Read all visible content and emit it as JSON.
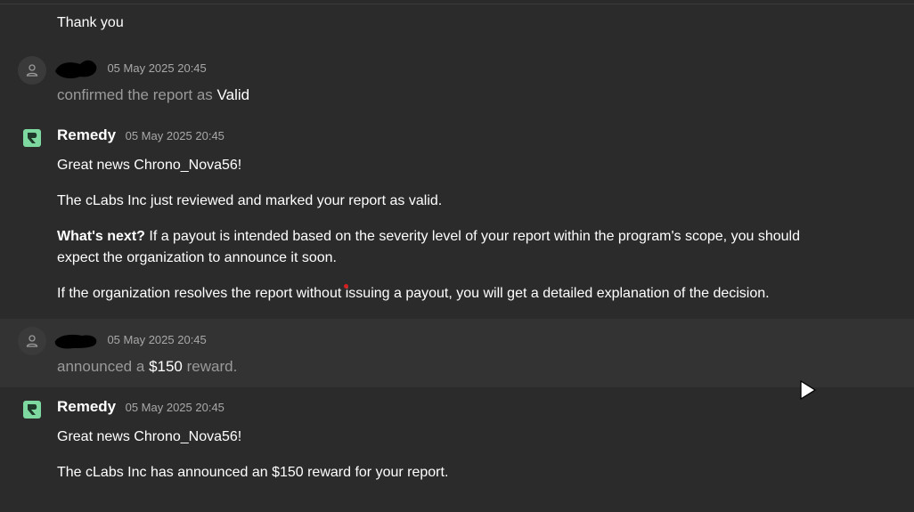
{
  "entries": {
    "prior_message": {
      "text": "Thank you"
    },
    "validation_event": {
      "timestamp": "05 May 2025 20:45",
      "action_text": "confirmed the report as",
      "status": "Valid"
    },
    "remedy_message_1": {
      "author": "Remedy",
      "timestamp": "05 May 2025 20:45",
      "greeting": "Great news Chrono_Nova56!",
      "line1": "The cLabs Inc just reviewed and marked your report as valid.",
      "whats_next_label": "What's next?",
      "whats_next_body": "If a payout is intended based on the severity level of your report within the program's scope, you should expect the organization to announce it soon.",
      "line3": "If the organization resolves the report without issuing a payout, you will get a detailed explanation of the decision."
    },
    "reward_event": {
      "timestamp": "05 May 2025 20:45",
      "action_prefix": "announced a",
      "amount": "$150",
      "action_suffix": "reward."
    },
    "remedy_message_2": {
      "author": "Remedy",
      "timestamp": "05 May 2025 20:45",
      "greeting": "Great news Chrono_Nova56!",
      "line1": "The cLabs Inc has announced an $150 reward for your report."
    }
  },
  "colors": {
    "background": "#2b2b2b",
    "highlight_background": "#333333",
    "remedy_brand": "#7ed9a0",
    "muted_text": "#9a9a9a"
  },
  "icons": {
    "user_avatar": "user-icon",
    "remedy_avatar": "remedy-logo-icon",
    "pointer": "mouse-cursor-icon"
  }
}
